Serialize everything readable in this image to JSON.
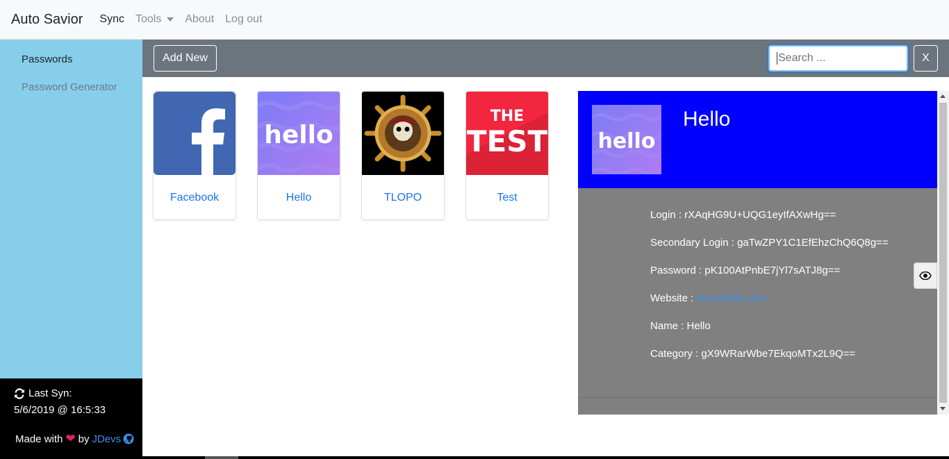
{
  "navbar": {
    "brand": "Auto Savior",
    "links": {
      "sync": "Sync",
      "tools": "Tools",
      "about": "About",
      "logout": "Log out"
    }
  },
  "sidebar": {
    "items": [
      "Passwords",
      "Password Generator"
    ],
    "footer": {
      "last_sync_label": "Last Syn:",
      "last_sync_date": "5/6/2019 @ 16:5:33",
      "made_with": "Made with",
      "by": "by",
      "author": "JDevs"
    }
  },
  "toolbar": {
    "add_new_label": "Add New",
    "search_placeholder": "Search ...",
    "clear_label": "X"
  },
  "cards": [
    {
      "title": "Facebook",
      "icon": "facebook-logo"
    },
    {
      "title": "Hello",
      "icon": "hello-logo"
    },
    {
      "title": "TLOPO",
      "icon": "pirate-wheel-logo"
    },
    {
      "title": "Test",
      "icon": "the-test-logo"
    }
  ],
  "detail": {
    "title": "Hello",
    "header_color": "#0000ff",
    "rows": {
      "login": "Login : rXAqHG9U+UQG1eyIfAXwHg==",
      "secondary_login": "Secondary Login : gaTwZPY1C1EfEhzChQ6Q8g==",
      "password": "Password : pK100AtPnbE7jYl7sATJ8g==",
      "website_label": "Website : ",
      "website_link": "www.hello.com",
      "name": "Name : Hello",
      "category": "Category : gX9WRarWbe7EkqoMTx2L9Q=="
    }
  },
  "colors": {
    "sidebar_bg": "#87ceeb",
    "toolbar_bg": "#6c757d",
    "detail_bg": "#808080",
    "link": "#1a73e8"
  }
}
